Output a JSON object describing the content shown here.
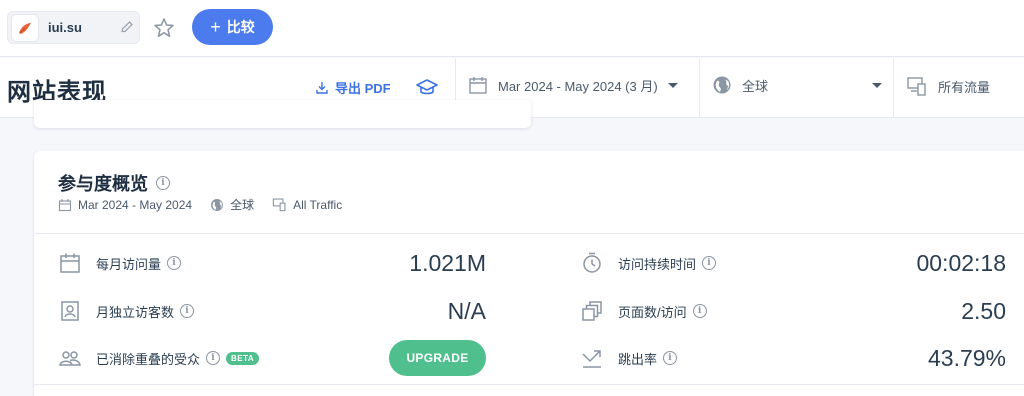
{
  "topbar": {
    "site_name": "iui.su",
    "compare_label": "比较"
  },
  "header": {
    "title": "网站表现",
    "export_label": "导出 PDF",
    "date_range": "Mar 2024 - May 2024 (3 月)",
    "geo": "全球",
    "traffic": "所有流量"
  },
  "engagement": {
    "title": "参与度概览",
    "meta_date": "Mar 2024 - May 2024",
    "meta_geo": "全球",
    "meta_traffic": "All Traffic",
    "metrics_left": [
      {
        "label": "每月访问量",
        "value": "1.021M"
      },
      {
        "label": "月独立访客数",
        "value": "N/A"
      },
      {
        "label": "已消除重叠的受众",
        "badge": "BETA",
        "button": "UPGRADE"
      }
    ],
    "metrics_right": [
      {
        "label": "访问持续时间",
        "value": "00:02:18"
      },
      {
        "label": "页面数/访问",
        "value": "2.50"
      },
      {
        "label": "跳出率",
        "value": "43.79%"
      }
    ]
  },
  "colors": {
    "accent": "#4b7bec",
    "upgrade": "#4fc08d",
    "text": "#2a3e52"
  }
}
